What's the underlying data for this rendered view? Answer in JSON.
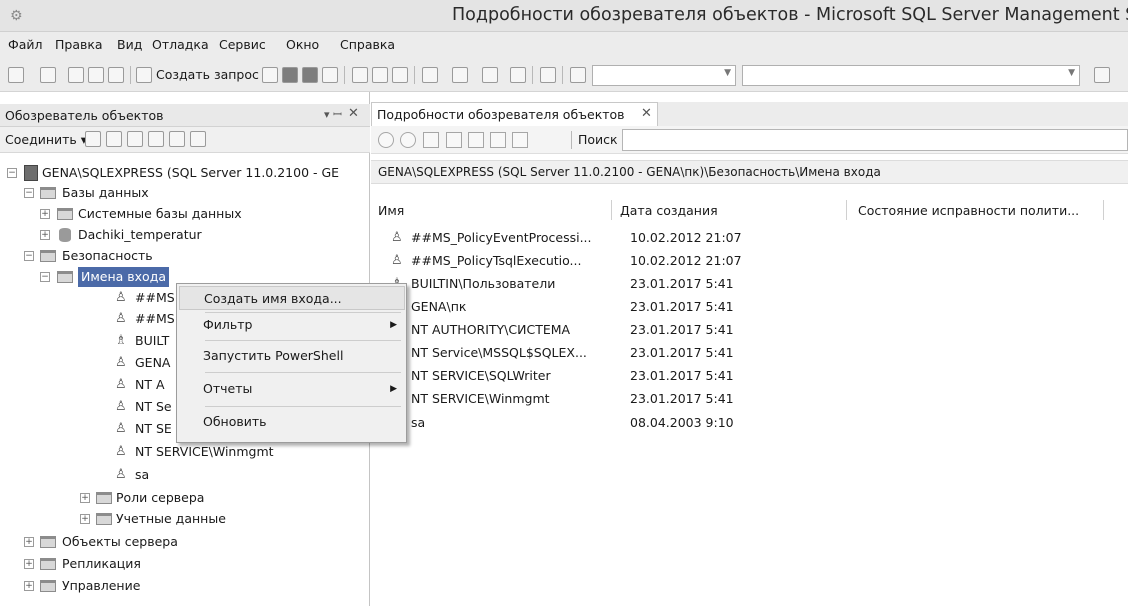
{
  "window": {
    "title": "Подробности обозревателя объектов - Microsoft SQL Server Management Studio"
  },
  "menubar": {
    "items": [
      "Файл",
      "Правка",
      "Вид",
      "Отладка",
      "Сервис",
      "Окно",
      "Справка"
    ]
  },
  "toolbar": {
    "new_query_label": "Создать запрос"
  },
  "object_explorer": {
    "title": "Обозреватель объектов",
    "pin_icon": "pin-icon",
    "close_icon": "close-icon",
    "connect_label": "Соединить ▾",
    "tree": {
      "server": "GENA\\SQLEXPRESS (SQL Server 11.0.2100 - GE",
      "databases": "Базы данных",
      "system_databases": "Системные базы данных",
      "db_dachiki": "Dachiki_temperatur",
      "security": "Безопасность",
      "logins": "Имена входа",
      "login_items": [
        "##MS",
        "##MS",
        "BUILT",
        "GENA",
        "NT A",
        "NT Se",
        "NT SE",
        "NT SERVICE\\Winmgmt",
        "sa"
      ],
      "server_roles": "Роли сервера",
      "credentials": "Учетные данные",
      "server_objects": "Объекты сервера",
      "replication": "Репликация",
      "management": "Управление"
    }
  },
  "context_menu": {
    "items": [
      "Создать имя входа...",
      "Фильтр",
      "Запустить PowerShell",
      "Отчеты",
      "Обновить"
    ]
  },
  "details": {
    "tab_label": "Подробности обозревателя объектов",
    "search_label": "Поиск",
    "path": "GENA\\SQLEXPRESS (SQL Server 11.0.2100 - GENA\\пк)\\Безопасность\\Имена входа",
    "columns": [
      "Имя",
      "Дата создания",
      "Состояние исправности полити..."
    ],
    "rows": [
      {
        "name": "##MS_PolicyEventProcessi...",
        "date": "10.02.2012 21:07"
      },
      {
        "name": "##MS_PolicyTsqlExecutio...",
        "date": "10.02.2012 21:07"
      },
      {
        "name": "BUILTIN\\Пользователи",
        "date": "23.01.2017 5:41"
      },
      {
        "name": "GENA\\пк",
        "date": "23.01.2017 5:41"
      },
      {
        "name": "NT AUTHORITY\\СИСТЕМА",
        "date": "23.01.2017 5:41"
      },
      {
        "name": "NT Service\\MSSQL$SQLEX...",
        "date": "23.01.2017 5:41"
      },
      {
        "name": "NT SERVICE\\SQLWriter",
        "date": "23.01.2017 5:41"
      },
      {
        "name": "NT SERVICE\\Winmgmt",
        "date": "23.01.2017 5:41"
      },
      {
        "name": "sa",
        "date": "08.04.2003 9:10"
      }
    ]
  }
}
